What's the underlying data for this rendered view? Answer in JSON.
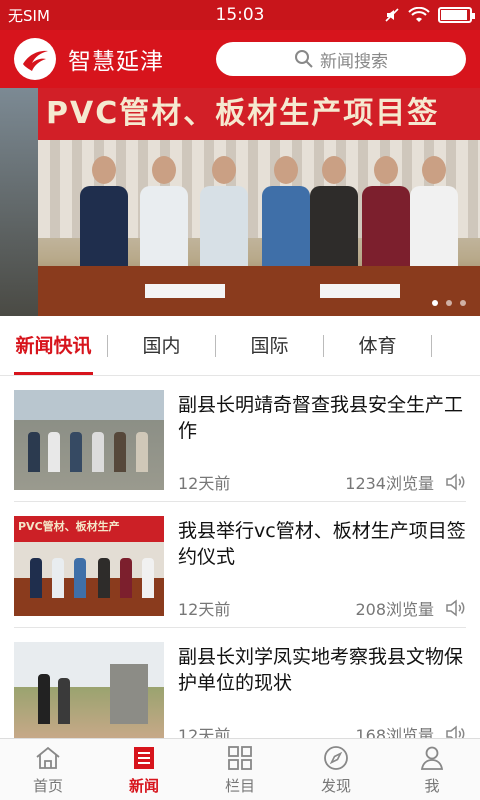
{
  "status_bar": {
    "carrier": "无SIM",
    "time": "15:03",
    "battery_level": 0.92
  },
  "header": {
    "app_title": "智慧延津",
    "search_placeholder": "新闻搜索"
  },
  "banner": {
    "sign_text": "PVC管材、板材生产项目签",
    "slide_count": 3,
    "active_slide": 1
  },
  "tabs": [
    {
      "label": "新闻快讯",
      "active": true
    },
    {
      "label": "国内",
      "active": false
    },
    {
      "label": "国际",
      "active": false
    },
    {
      "label": "体育",
      "active": false
    }
  ],
  "news": [
    {
      "title": "副县长明靖奇督查我县安全生产工作",
      "time": "12天前",
      "views": "1234浏览量"
    },
    {
      "title": "我县举行vc管材、板材生产项目签约仪式",
      "time": "12天前",
      "views": "208浏览量",
      "thumb_text": "PVC管材、板材生产"
    },
    {
      "title": "副县长刘学凤实地考察我县文物保护单位的现状",
      "time": "12天前",
      "views": "168浏览量"
    }
  ],
  "bottom_nav": [
    {
      "label": "首页",
      "icon": "home-icon",
      "active": false
    },
    {
      "label": "新闻",
      "icon": "news-icon",
      "active": true
    },
    {
      "label": "栏目",
      "icon": "grid-icon",
      "active": false
    },
    {
      "label": "发现",
      "icon": "compass-icon",
      "active": false
    },
    {
      "label": "我",
      "icon": "user-icon",
      "active": false
    }
  ],
  "colors": {
    "brand_red": "#d7141c",
    "status_red": "#c8151b"
  }
}
